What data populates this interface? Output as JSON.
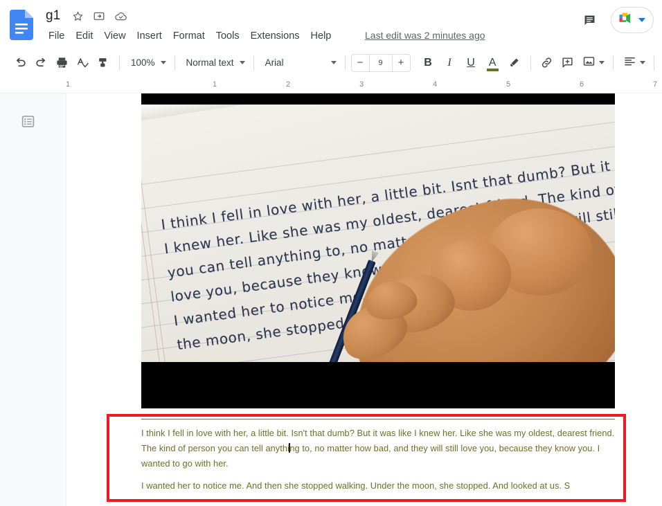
{
  "app": {
    "name": "Google Docs",
    "logo_icon": "docs-file-icon"
  },
  "header": {
    "doc_title": "g1",
    "star_icon": "star-outline-icon",
    "move_icon": "move-to-folder-icon",
    "cloud_icon": "cloud-saved-icon",
    "menus": [
      "File",
      "Edit",
      "View",
      "Insert",
      "Format",
      "Tools",
      "Extensions",
      "Help"
    ],
    "last_edit": "Last edit was 2 minutes ago",
    "comment_history_icon": "comment-history-icon",
    "meet_icon": "google-meet-icon",
    "meet_caret_icon": "chevron-down-icon"
  },
  "toolbar": {
    "undo_icon": "undo-icon",
    "redo_icon": "redo-icon",
    "print_icon": "print-icon",
    "spellcheck_icon": "spellcheck-icon",
    "paint_format_icon": "paint-format-icon",
    "zoom_value": "100%",
    "style_value": "Normal text",
    "font_value": "Arial",
    "font_size_decrease": "−",
    "font_size_value": "9",
    "font_size_increase": "+",
    "bold_label": "B",
    "italic_label": "I",
    "underline_label": "U",
    "text_color_label": "A",
    "text_color_swatch": "#6e7029",
    "highlight_icon": "highlight-pen-icon",
    "link_icon": "insert-link-icon",
    "comment_icon": "add-comment-icon",
    "image_icon": "insert-image-icon",
    "align_icon": "align-left-icon",
    "line_spacing_icon": "line-spacing-icon"
  },
  "ruler": {
    "numbers": [
      "1",
      "1",
      "2",
      "3",
      "4",
      "5",
      "6",
      "7"
    ],
    "left_margin_marker": "left-indent-marker",
    "right_margin_marker": "right-indent-marker"
  },
  "sidebar": {
    "outline_icon": "document-outline-icon"
  },
  "document": {
    "image": {
      "alt": "Photo of a hand writing cursive text on lined notebook paper with a blue pencil",
      "handwriting_lines": [
        "I think I fell in love with her, a little bit. Isnt that dumb? But it was like",
        "I knew her. Like she was my oldest, dearest friend. The kind of person",
        "you can tell anything to, no matter how bad, and they will still",
        "love you, because they know you. I wanted to go with her.",
        "I wanted her to notice me. And then she stopped walking. Under",
        "the moon, she stopped. And looked at us. S"
      ]
    },
    "horizontal_rule": "horizontal-divider",
    "paragraphs": [
      "I think I fell in love with her, a little bit. Isn't that dumb? But it was like I knew her. Like she was my oldest, dearest friend. The kind of person you can tell anything to, no matter how bad, and they will still love you, because they know you. I wanted to go with her.",
      "I wanted her to notice me. And then she stopped walking. Under the moon, she stopped. And looked at us. S"
    ],
    "paragraph_1_before_caret": "I think I fell in love with her, a little bit. Isn't that dumb? But it was like I knew her. Like she was my oldest, dearest friend. The kind of person you can tell anythi",
    "paragraph_1_after_caret": "ng to, no matter how bad, and they will still love you, because they know you. I wanted to go with her.",
    "text_color": "#6e7029",
    "annotation_box_color": "#ed1c24"
  }
}
